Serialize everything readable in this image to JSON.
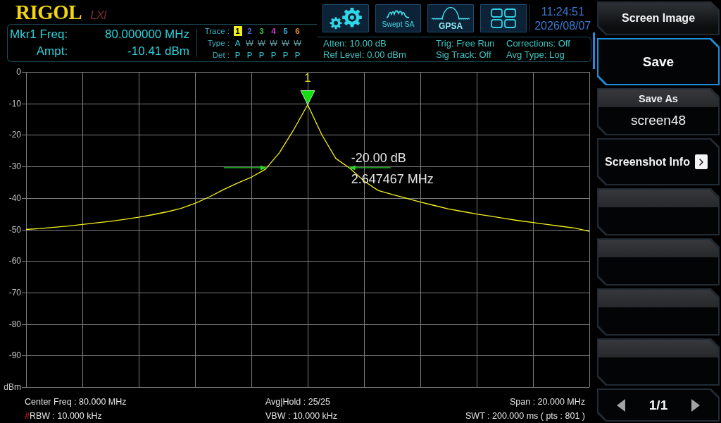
{
  "header": {
    "logo": "RIGOL",
    "logo_suffix": "LXI"
  },
  "marker_readout": {
    "freq_label": "Mkr1 Freq:",
    "freq_value": "80.000000 MHz",
    "ampt_label": "Ampt:",
    "ampt_value": "-10.41 dBm"
  },
  "trace_panel": {
    "trace_label": "Trace :",
    "type_label": "Type :",
    "det_label": "Det :",
    "traces": [
      {
        "number": "1",
        "color": "#f2ee1a",
        "selected": true,
        "type": "A",
        "on": true,
        "det": "P"
      },
      {
        "number": "2",
        "color": "#4a6ae0",
        "selected": false,
        "type": "W",
        "on": false,
        "det": "P"
      },
      {
        "number": "3",
        "color": "#3cc23c",
        "selected": false,
        "type": "W",
        "on": false,
        "det": "P"
      },
      {
        "number": "4",
        "color": "#d23cd8",
        "selected": false,
        "type": "W",
        "on": false,
        "det": "P"
      },
      {
        "number": "5",
        "color": "#3aa6dc",
        "selected": false,
        "type": "W",
        "on": false,
        "det": "P"
      },
      {
        "number": "6",
        "color": "#de8a3c",
        "selected": false,
        "type": "W",
        "on": false,
        "det": "P"
      }
    ]
  },
  "mode_buttons": [
    {
      "kind": "settings"
    },
    {
      "kind": "swept",
      "label": "Swept SA"
    },
    {
      "kind": "gpsa",
      "label": "GPSA"
    },
    {
      "kind": "layout"
    }
  ],
  "clock": {
    "time": "11:24:51",
    "date": "2026/08/07"
  },
  "settings": [
    [
      "Atten: 10.00 dB",
      "Ref Level: 0.00 dBm"
    ],
    [
      "Trig: Free Run",
      "Sig Track: Off"
    ],
    [
      "Corrections: Off",
      "Avg Type: Log"
    ]
  ],
  "chart_data": {
    "type": "line",
    "grid": true,
    "categories": [
      null,
      null,
      null,
      null,
      null,
      null,
      null,
      null,
      null,
      null,
      null,
      null,
      null,
      null,
      null,
      null,
      null,
      null,
      null,
      null,
      null,
      null,
      null,
      null,
      null,
      null,
      null,
      null,
      null,
      null,
      null,
      null,
      null,
      null,
      null,
      null,
      null,
      null,
      null,
      null,
      null
    ],
    "series": [
      {
        "color": "#f5f21a",
        "values": [
          -50.0,
          -49.7,
          -49.3,
          -48.9,
          -48.4,
          -47.9,
          -47.4,
          -46.8,
          -46.1,
          -45.3,
          -44.4,
          -43.3,
          -41.7,
          -39.7,
          -37.4,
          -35.3,
          -33.4,
          -30.9,
          -25.6,
          -18.4,
          -10.4,
          -19.9,
          -27.5,
          -30.6,
          -34.6,
          -37.6,
          -38.9,
          -40.1,
          -41.3,
          -42.4,
          -43.5,
          -44.3,
          -45.1,
          -45.8,
          -46.5,
          -47.2,
          -47.8,
          -48.4,
          -49.0,
          -49.6,
          -50.6
        ]
      }
    ],
    "ylim": [
      -100,
      0
    ],
    "yticks": [
      {
        "value": 0,
        "label": "0"
      },
      {
        "value": -10,
        "label": "-10"
      },
      {
        "value": -20,
        "label": "-20"
      },
      {
        "value": -30,
        "label": "-30"
      },
      {
        "value": -40,
        "label": "-40"
      },
      {
        "value": -50,
        "label": "-50"
      },
      {
        "value": -60,
        "label": "-60"
      },
      {
        "value": -70,
        "label": "-70"
      },
      {
        "value": -80,
        "label": "-80"
      },
      {
        "value": -90,
        "label": "-90"
      },
      {
        "value": -100,
        "label": "dBm"
      }
    ]
  },
  "marker": {
    "label": "1"
  },
  "n_db": {
    "offset": "-20.00 dB",
    "bandwidth": "2.647467 MHz"
  },
  "status_bar": {
    "rows": [
      [
        {
          "text": "Center Freq : 80.000 MHz"
        },
        {
          "text": "Avg|Hold : 25/25"
        },
        {
          "text": "Span : 20.000 MHz"
        }
      ],
      [
        {
          "flag": "#",
          "text": "RBW : 10.000 kHz"
        },
        {
          "text": "VBW : 10.000 kHz"
        },
        {
          "text": "SWT : 200.000 ms ( pts : 801 )"
        }
      ]
    ]
  },
  "menu": {
    "title": "Screen Image",
    "keys": [
      {
        "kind": "action",
        "label": "Save",
        "selected": true
      },
      {
        "kind": "value",
        "label": "Save As",
        "value": "screen48",
        "selected": false
      },
      {
        "kind": "submenu",
        "label": "Screenshot Info",
        "selected": false
      },
      {
        "kind": "blank",
        "selected": false
      },
      {
        "kind": "blank",
        "selected": false
      },
      {
        "kind": "blank",
        "selected": false
      },
      {
        "kind": "blank",
        "selected": false
      }
    ],
    "page": "1/1"
  }
}
